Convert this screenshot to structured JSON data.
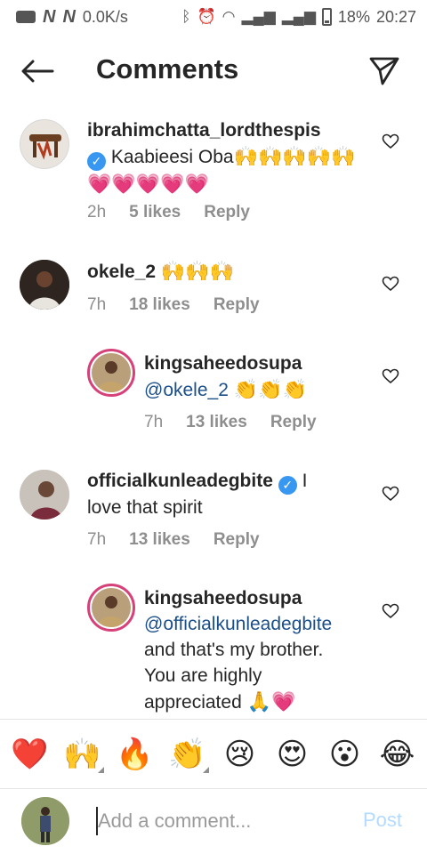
{
  "status_bar": {
    "speed": "0.0K/s",
    "battery": "18%",
    "time": "20:27"
  },
  "header": {
    "title": "Comments",
    "back_icon": "arrow-left-icon",
    "share_icon": "paper-plane-icon"
  },
  "comments": [
    {
      "username": "ibrahimchatta_lordthespis",
      "text": "Kaabieesi Oba",
      "emojis_line1": "🙌🙌🙌🙌🙌",
      "emojis_line2": "💗💗💗💗💗",
      "time": "2h",
      "likes": "5 likes",
      "reply": "Reply",
      "verified_inline": true
    },
    {
      "username": "okele_2",
      "emojis": "🙌🙌🙌",
      "time": "7h",
      "likes": "18 likes",
      "reply": "Reply"
    },
    {
      "username": "kingsaheedosupa",
      "mention": "@okele_2",
      "emojis": "👏👏👏",
      "time": "7h",
      "likes": "13 likes",
      "reply": "Reply"
    },
    {
      "username": "officialkunleadegbite",
      "text_part1": "I",
      "text_part2": "love that spirit",
      "time": "7h",
      "likes": "13 likes",
      "reply": "Reply"
    },
    {
      "username": "kingsaheedosupa",
      "mention": "@officialkunleadegbite",
      "line2": "and that's my brother.",
      "line3": "You are highly",
      "line4": "appreciated",
      "emojis": "🙏💗"
    }
  ],
  "reactions": [
    "❤️",
    "🙌",
    "🔥",
    "👏",
    "😢",
    "😍",
    "😮",
    "😂"
  ],
  "input": {
    "placeholder": "Add a comment...",
    "post_label": "Post"
  },
  "colors": {
    "text": "#262626",
    "meta": "#8e8e8e",
    "mention": "#1b4f8a",
    "verified": "#3897f0",
    "post_disabled": "#b3dbff",
    "story_ring": "#d6417a"
  }
}
